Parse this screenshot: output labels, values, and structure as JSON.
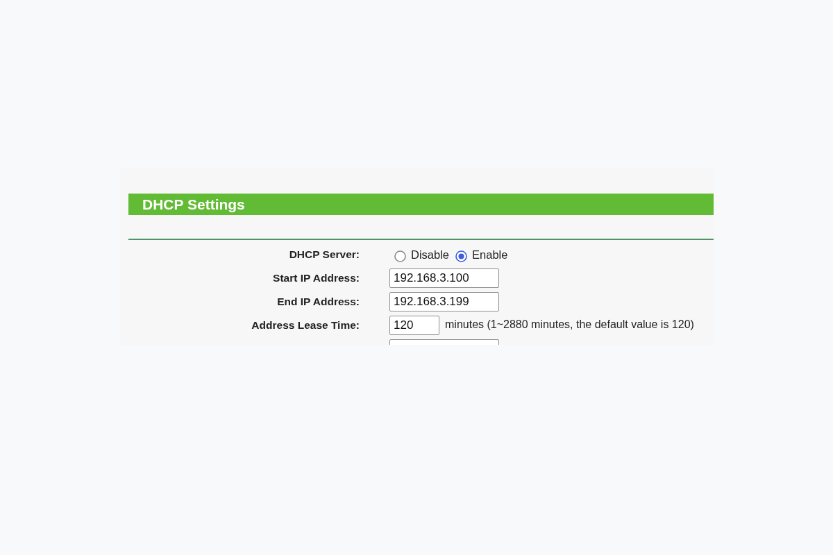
{
  "title": "DHCP Settings",
  "fields": [
    {
      "kind": "radio",
      "label": "DHCP Server:",
      "options": [
        {
          "label": "Disable",
          "selected": false
        },
        {
          "label": "Enable",
          "selected": true
        }
      ]
    },
    {
      "kind": "input",
      "label": "Start IP Address:",
      "value": "192.168.3.100"
    },
    {
      "kind": "input",
      "label": "End IP Address:",
      "value": "192.168.3.199"
    },
    {
      "kind": "number",
      "label": "Address Lease Time:",
      "value": "120",
      "note": "minutes (1~2880 minutes, the default value is 120)"
    },
    {
      "kind": "input"
    }
  ]
}
